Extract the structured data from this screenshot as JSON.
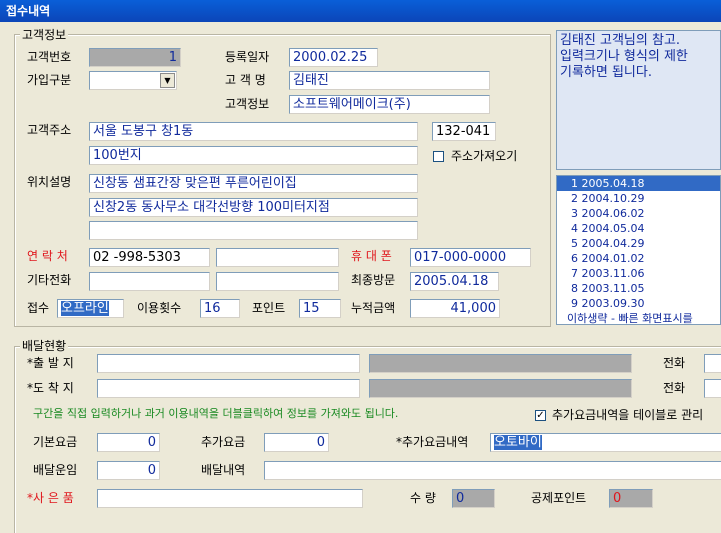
{
  "window": {
    "title": "접수내역"
  },
  "customer_group": {
    "title": "고객정보",
    "customer_no_label": "고객번호",
    "customer_no": "1",
    "reg_date_label": "등록일자",
    "reg_date": "2000.02.25",
    "join_type_label": "가입구분",
    "join_type": "",
    "name_label": "고 객 명",
    "name": "김태진",
    "info_label": "고객정보",
    "info": "소프트웨어메이크(주)",
    "address_label": "고객주소",
    "address1": "서울 도봉구 창1동",
    "zipcode": "132-041",
    "address2": "100번지",
    "address_fetch_label": "주소가져오기",
    "location_label": "위치설명",
    "location1": "신창동 샘표간장 맞은편 푸른어린이집",
    "location2": "신창2동 동사무소 대각선방향 100미터지점",
    "location3": "",
    "contact_label": "연 락 처",
    "contact1": "02  -998-5303",
    "contact2": "",
    "mobile_label": "휴 대 폰",
    "mobile": "017-000-0000",
    "other_phone_label": "기타전화",
    "other_phone1": "",
    "other_phone2": "",
    "last_visit_label": "최종방문",
    "last_visit": "2005.04.18",
    "receipt_label": "접수",
    "receipt": "오프라인",
    "use_count_label": "이용횟수",
    "use_count": "16",
    "point_label": "포인트",
    "point": "15",
    "total_amount_label": "누적금액",
    "total_amount": "41,000"
  },
  "memo": {
    "lines": [
      "김태진 고객님의 참고.",
      "입력크기나 형식의 제한",
      "기록하면 됩니다."
    ]
  },
  "history": {
    "items": [
      "1 2005.04.18",
      "2 2004.10.29",
      "3 2004.06.02",
      "4 2004.05.04",
      "5 2004.04.29",
      "6 2004.01.02",
      "7 2003.11.06",
      "8 2003.11.05",
      "9 2003.09.30"
    ],
    "note": "이하생략 - 빠른 화면표시를"
  },
  "delivery_group": {
    "title": "배달현황",
    "origin_label": "*출 발 지",
    "origin": "",
    "origin_detail": "",
    "dest_label": "*도 착 지",
    "dest": "",
    "dest_detail": "",
    "phone_label": "전화",
    "hint": "구간을 직접 입력하거나 과거 이용내역을 더블클릭하여 정보를 가져와도 됩니다.",
    "extra_fee_table_label": "추가요금내역을 테이블로 관리",
    "base_fee_label": "기본요금",
    "base_fee": "0",
    "extra_fee_label": "추가요금",
    "extra_fee": "0",
    "extra_detail_label": "*추가요금내역",
    "extra_detail": "오토바이",
    "delivery_fee_label": "배달운임",
    "delivery_fee": "0",
    "delivery_detail_label": "배달내역",
    "delivery_detail": "",
    "gift_label": "*사 은 품",
    "gift": "",
    "qty_label": "수 량",
    "qty": "0",
    "deduct_point_label": "공제포인트",
    "deduct_point": "0"
  }
}
